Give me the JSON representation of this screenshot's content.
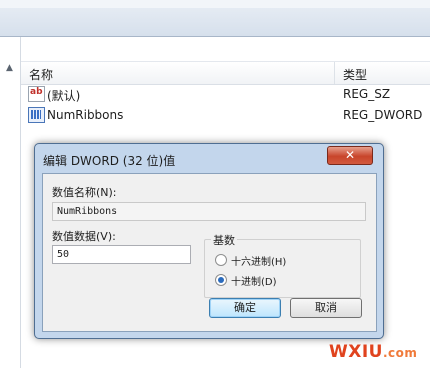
{
  "list": {
    "columns": [
      "名称",
      "类型"
    ],
    "rows": [
      {
        "icon": "string-value-icon",
        "name": "(默认)",
        "type": "REG_SZ"
      },
      {
        "icon": "dword-value-icon",
        "name": "NumRibbons",
        "type": "REG_DWORD"
      }
    ]
  },
  "dialog": {
    "title": "编辑 DWORD (32 位)值",
    "close_glyph": "✕",
    "value_name_label": "数值名称(N):",
    "value_name": "NumRibbons",
    "value_data_label": "数值数据(V):",
    "value_data": "50",
    "base_label": "基数",
    "base_options": [
      "十六进制(H)",
      "十进制(D)"
    ],
    "base_selected": "十进制(D)",
    "ok_label": "确定",
    "cancel_label": "取消"
  },
  "watermark": {
    "main": "WXIU",
    "suffix": ".com"
  },
  "colors": {
    "accent": "#2a6bbd",
    "dialog_frame": "#c3d6ec",
    "close": "#c8452b",
    "watermark": "#e0431e"
  }
}
